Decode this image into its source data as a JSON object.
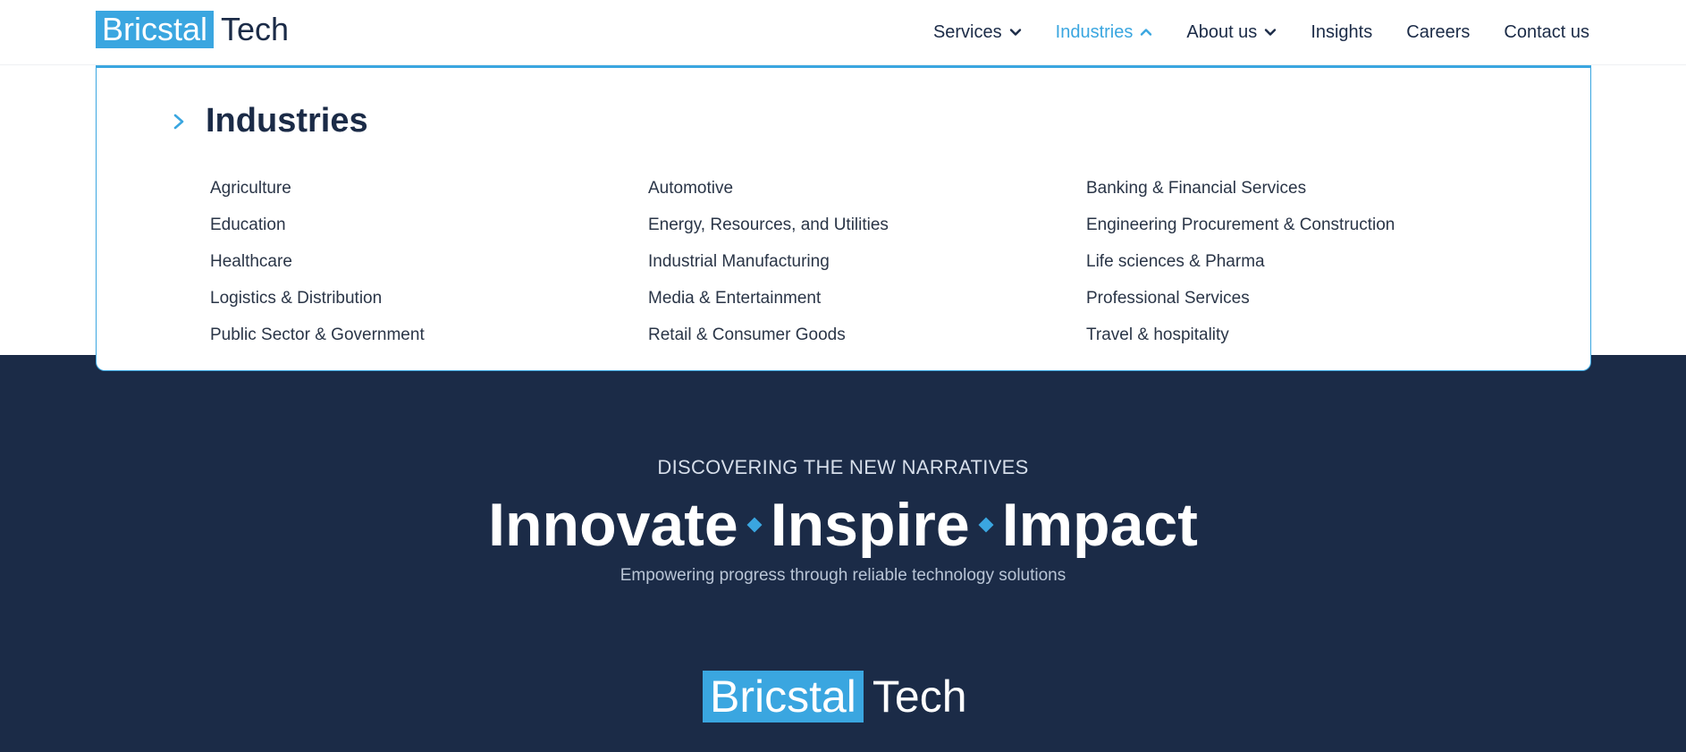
{
  "brand": {
    "part1": "Bricstal",
    "part2": "Tech"
  },
  "nav": [
    {
      "label": "Services",
      "icon": "chevron-down-icon"
    },
    {
      "label": "Industries",
      "icon": "chevron-up-icon",
      "active": true
    },
    {
      "label": "About us",
      "icon": "chevron-down-icon"
    },
    {
      "label": "Insights"
    },
    {
      "label": "Careers"
    },
    {
      "label": "Contact us"
    }
  ],
  "mega_menu": {
    "title": "Industries",
    "columns": [
      [
        "Agriculture",
        "Education",
        "Healthcare",
        "Logistics & Distribution",
        "Public Sector & Government"
      ],
      [
        "Automotive",
        "Energy, Resources, and Utilities",
        "Industrial Manufacturing",
        "Media & Entertainment",
        "Retail & Consumer Goods"
      ],
      [
        "Banking & Financial Services",
        "Engineering Procurement & Construction",
        "Life sciences & Pharma",
        "Professional Services",
        "Travel & hospitality"
      ]
    ]
  },
  "hero": {
    "eyebrow": "DISCOVERING THE NEW NARRATIVES",
    "title_words": [
      "Innovate",
      "Inspire",
      "Impact"
    ],
    "subtitle": "Empowering progress through reliable technology solutions"
  },
  "colors": {
    "accent": "#3aa6e0",
    "navy": "#1b2b47",
    "white": "#ffffff"
  }
}
